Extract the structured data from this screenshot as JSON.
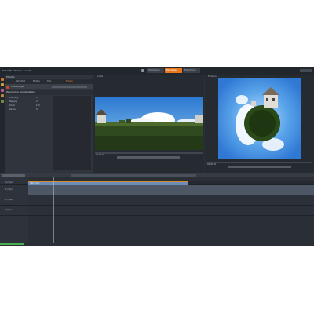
{
  "titlebar": {
    "menu_left": "Datei   Bearbeiten   Ansicht",
    "modes": [
      {
        "label": "Importieren",
        "active": false
      },
      {
        "label": "Bearbeiten",
        "active": true
      },
      {
        "label": "Exportieren",
        "active": false
      }
    ]
  },
  "left_panel": {
    "header": "Effekte",
    "tabs": [
      "Bibliothek",
      "Medien",
      "Titel",
      "Effekte"
    ],
    "subbar": "Einstellungen",
    "effect_title": "Panorama zu Kugelprojektion",
    "params": [
      {
        "label": "Drehung",
        "value": "0"
      },
      {
        "label": "Neigung",
        "value": "0"
      },
      {
        "label": "Zoom",
        "value": "100"
      },
      {
        "label": "Radius",
        "value": "50"
      }
    ]
  },
  "source_monitor": {
    "title": "Quelle",
    "timecode": "00:00:00"
  },
  "program_monitor": {
    "title": "Timeline",
    "timecode": "00:00:00"
  },
  "timeline": {
    "tracks": [
      "(A) Spur",
      "(1) Spur",
      "(2) Spur",
      "(3) Spur"
    ],
    "clip_label": "360-Video"
  },
  "colors": {
    "accent": "#e8761a",
    "clip_top": "#d98a2b",
    "clip_body": "#6c8db5",
    "panel": "#2c3038"
  }
}
